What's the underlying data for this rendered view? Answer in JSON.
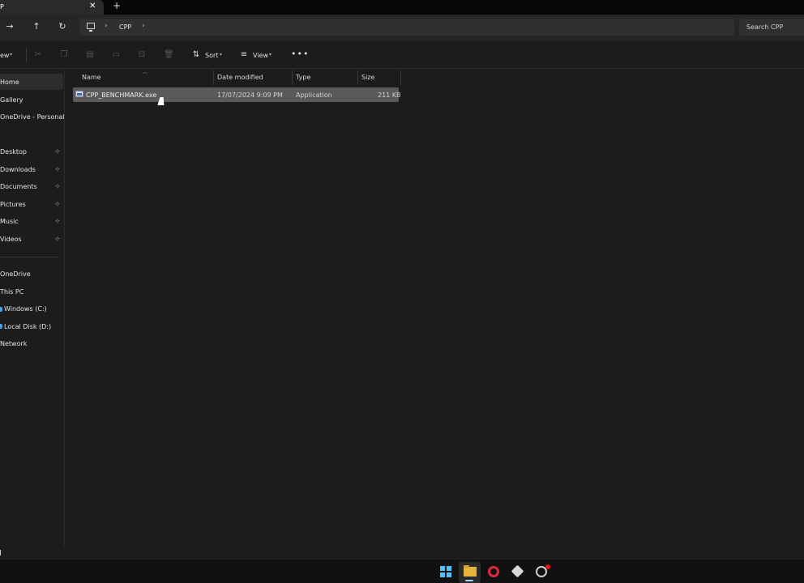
{
  "window": {
    "tab_title": "P",
    "close_glyph": "✕",
    "new_tab_glyph": "+"
  },
  "nav": {
    "forward_glyph": "→",
    "up_glyph": "↑",
    "refresh_glyph": "↻"
  },
  "address": {
    "separator": "›",
    "crumb": "CPP",
    "search_placeholder": "Search CPP"
  },
  "toolbar": {
    "new_label": "ew",
    "sort_label": "Sort",
    "view_label": "View",
    "more_label": "•••",
    "caret": "▾"
  },
  "sidebar": {
    "items": [
      {
        "label": "Home"
      },
      {
        "label": "Gallery"
      },
      {
        "label": "OneDrive - Personal"
      },
      {
        "label": "Desktop",
        "pinned": true
      },
      {
        "label": "Downloads",
        "pinned": true
      },
      {
        "label": "Documents",
        "pinned": true
      },
      {
        "label": "Pictures",
        "pinned": true
      },
      {
        "label": "Music",
        "pinned": true
      },
      {
        "label": "Videos",
        "pinned": true
      },
      {
        "label": "OneDrive"
      },
      {
        "label": "This PC"
      },
      {
        "label": "Windows (C:)"
      },
      {
        "label": "Local Disk (D:)"
      },
      {
        "label": "Network"
      }
    ],
    "pin_glyph": "📌"
  },
  "file_list": {
    "columns": [
      "Name",
      "Date modified",
      "Type",
      "Size"
    ],
    "rows": [
      {
        "name": "CPP_BENCHMARK.exe",
        "date_modified": "17/07/2024 9:09 PM",
        "type": "Application",
        "size": "211 KB"
      }
    ]
  },
  "colors": {
    "selection": "#5a5a5a",
    "windows_accent": "#4cc2ff",
    "folder": "#e7b53b",
    "opera": "#e0283a"
  }
}
